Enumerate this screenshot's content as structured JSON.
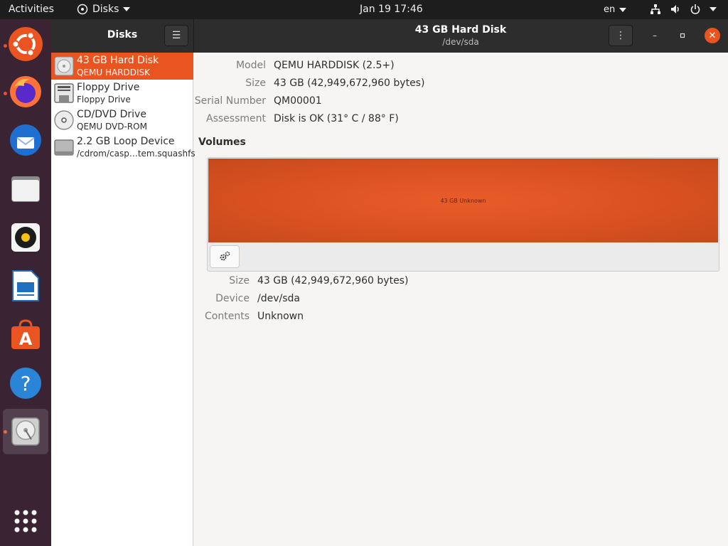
{
  "topbar": {
    "activities": "Activities",
    "app_name": "Disks",
    "clock": "Jan 19  17:46",
    "language": "en"
  },
  "dock": {
    "items": [
      "ubuntu-logo-icon",
      "firefox-icon",
      "thunderbird-icon",
      "files-icon",
      "rhythmbox-icon",
      "writer-icon",
      "software-icon",
      "help-icon",
      "disks-icon",
      "show-apps-icon"
    ]
  },
  "window": {
    "sidebar_title": "Disks",
    "title": "43 GB Hard Disk",
    "subtitle": "/dev/sda"
  },
  "sidebar": {
    "items": [
      {
        "name": "43 GB Hard Disk",
        "sub": "QEMU HARDDISK"
      },
      {
        "name": "Floppy Drive",
        "sub": "Floppy Drive"
      },
      {
        "name": "CD/DVD Drive",
        "sub": "QEMU DVD-ROM"
      },
      {
        "name": "2.2 GB Loop Device",
        "sub": "/cdrom/casp…tem.squashfs"
      }
    ]
  },
  "disk": {
    "model_label": "Model",
    "model": "QEMU HARDDISK (2.5+)",
    "size_label": "Size",
    "size": "43 GB (42,949,672,960 bytes)",
    "serial_label": "Serial Number",
    "serial": "QM00001",
    "assessment_label": "Assessment",
    "assessment": "Disk is OK (31° C / 88° F)"
  },
  "volumes": {
    "heading": "Volumes",
    "partition_label": "43 GB Unknown",
    "size_label": "Size",
    "size": "43 GB (42,949,672,960 bytes)",
    "device_label": "Device",
    "device": "/dev/sda",
    "contents_label": "Contents",
    "contents": "Unknown"
  },
  "colors": {
    "accent": "#e95420",
    "dock_bg": "#3a2434",
    "topbar_bg": "#1d1d1d",
    "headerbar_bg": "#2d2d2d"
  }
}
